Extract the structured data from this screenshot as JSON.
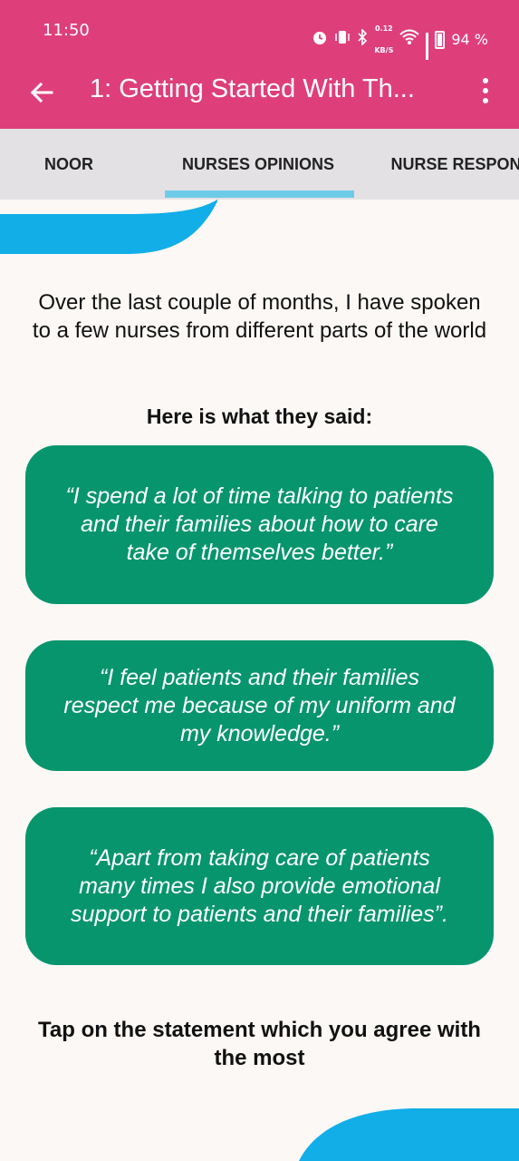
{
  "status_bar": {
    "time": "11:50",
    "net_speed_value": "0.12",
    "net_speed_unit": "KB/S",
    "battery": "94 %",
    "icons": [
      "alarm-icon",
      "vibrate-icon",
      "bluetooth-icon",
      "wifi-icon",
      "signal-icon",
      "battery-icon"
    ]
  },
  "app_bar": {
    "title": "1: Getting Started With Th...",
    "back_icon": "arrow-left-icon",
    "menu_icon": "more-vertical-icon"
  },
  "tabs": [
    {
      "label": "NOOR",
      "selected": false
    },
    {
      "label": "NURSES OPINIONS",
      "selected": true
    },
    {
      "label": "NURSE RESPONSIBILITI",
      "selected": false
    }
  ],
  "content": {
    "intro": "Over the last couple of months, I have spoken to a few nurses from different parts of the world",
    "subheading": "Here is what they said:",
    "statements": [
      "“I spend a lot of time talking to patients and their families about how to care take of themselves better.”",
      "“I feel patients and their families respect me because of my uniform and my knowledge.”",
      "“Apart from taking care of patients many times I also provide emotional support to patients and their families”."
    ],
    "prompt": "Tap on the statement which you agree with the most"
  },
  "colors": {
    "app_bar": "#de3f7a",
    "tab_bar": "#e3e1e4",
    "tab_indicator": "#6ecbe8",
    "card": "#07956d",
    "background": "#fbf8f5",
    "deco_blue": "#12aee8"
  }
}
